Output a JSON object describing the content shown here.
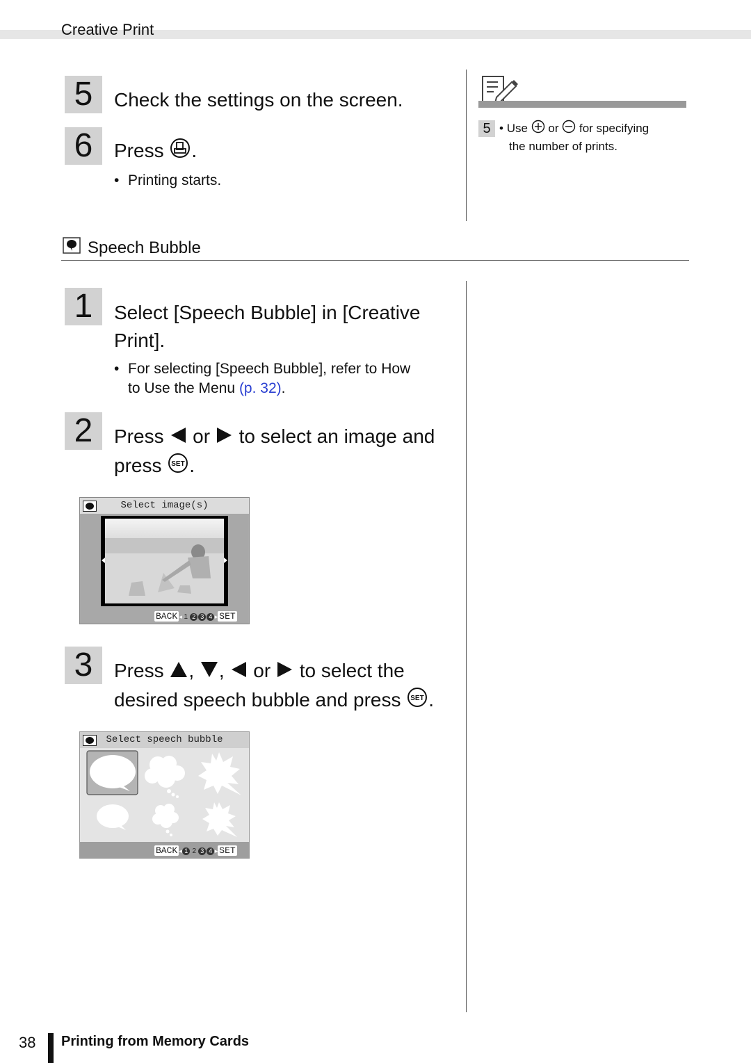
{
  "header": {
    "section_title": "Creative Print"
  },
  "steps_top": [
    {
      "number": "5",
      "text": "Check the settings on the screen."
    },
    {
      "number": "6",
      "text_before": "Press",
      "icon": "print-button-icon",
      "text_after": ".",
      "bullets": [
        "Printing starts."
      ]
    }
  ],
  "sidenote": {
    "icon": "memo-pencil-icon",
    "step_number": "5",
    "text_use": "Use",
    "plus_icon": "plus-circle-icon",
    "text_or": "or",
    "minus_icon": "minus-circle-icon",
    "text_rest_line1": "for specifying",
    "text_line2": "the number of prints."
  },
  "section": {
    "icon": "speech-bubble-icon",
    "title": "Speech Bubble"
  },
  "steps": [
    {
      "number": "1",
      "line1": "Select [Speech Bubble] in [Creative",
      "line2": "Print].",
      "bullet_line1": "For selecting [Speech Bubble], refer to How",
      "bullet_line2_text": "to Use the Menu",
      "bullet_link": "(p. 32)",
      "bullet_end": "."
    },
    {
      "number": "2",
      "press": "Press",
      "or": "or",
      "rest": "to select an image and",
      "line2_press": "press",
      "end": "."
    },
    {
      "number": "3",
      "press": "Press",
      "comma1": ",",
      "comma2": ",",
      "or": "or",
      "rest": "to select the",
      "line2": "desired speech bubble and press",
      "end": "."
    }
  ],
  "screen1": {
    "title": "Select image(s)",
    "footer": {
      "back": "BACK",
      "steps": [
        "1",
        "2",
        "3",
        "4"
      ],
      "current_step": "1",
      "set": "SET"
    }
  },
  "screen2": {
    "title": "Select speech bubble",
    "bubbles": [
      "oval-large",
      "cloud-large",
      "burst-large",
      "oval-small",
      "cloud-small",
      "burst-small"
    ],
    "selected_index": 0,
    "footer": {
      "back": "BACK",
      "steps": [
        "1",
        "2",
        "3",
        "4"
      ],
      "current_step": "2",
      "set": "SET"
    }
  },
  "footer": {
    "page_number": "38",
    "chapter": "Printing from Memory Cards"
  }
}
